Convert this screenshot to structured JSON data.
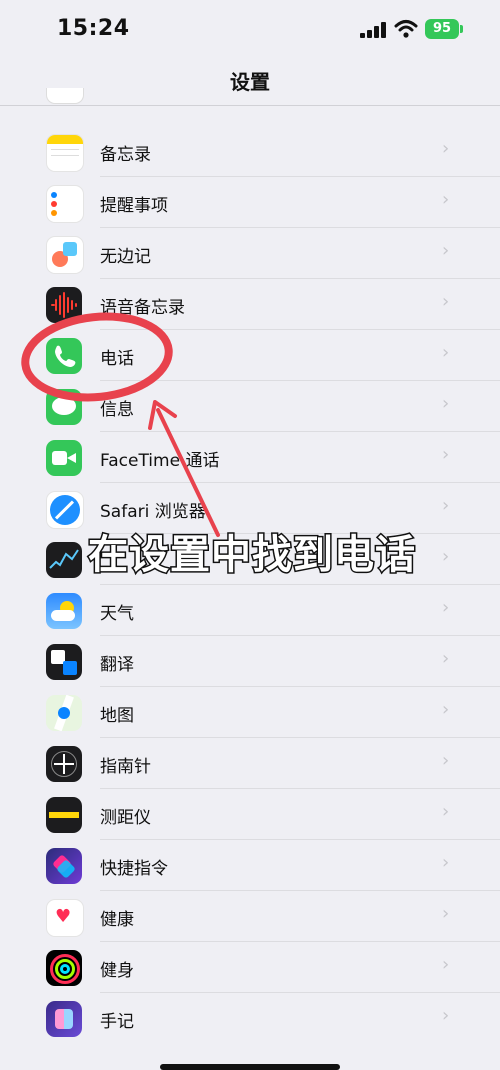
{
  "status": {
    "time": "15:24",
    "battery": "95"
  },
  "nav": {
    "title": "设置"
  },
  "rows": [
    {
      "label": "备忘录",
      "icon": "notes-icon"
    },
    {
      "label": "提醒事项",
      "icon": "reminders-icon"
    },
    {
      "label": "无边记",
      "icon": "freeform-icon"
    },
    {
      "label": "语音备忘录",
      "icon": "voice-memos-icon"
    },
    {
      "label": "电话",
      "icon": "phone-icon"
    },
    {
      "label": "信息",
      "icon": "messages-icon"
    },
    {
      "label": "FaceTime 通话",
      "icon": "facetime-icon"
    },
    {
      "label": "Safari 浏览器",
      "icon": "safari-icon"
    },
    {
      "label": "",
      "icon": "stocks-icon"
    },
    {
      "label": "天气",
      "icon": "weather-icon"
    },
    {
      "label": "翻译",
      "icon": "translate-icon"
    },
    {
      "label": "地图",
      "icon": "maps-icon"
    },
    {
      "label": "指南针",
      "icon": "compass-icon"
    },
    {
      "label": "测距仪",
      "icon": "measure-icon"
    },
    {
      "label": "快捷指令",
      "icon": "shortcuts-icon"
    },
    {
      "label": "健康",
      "icon": "health-icon"
    },
    {
      "label": "健身",
      "icon": "fitness-icon"
    },
    {
      "label": "手记",
      "icon": "journal-icon"
    }
  ],
  "overlay": {
    "caption": "在设置中找到电话"
  }
}
